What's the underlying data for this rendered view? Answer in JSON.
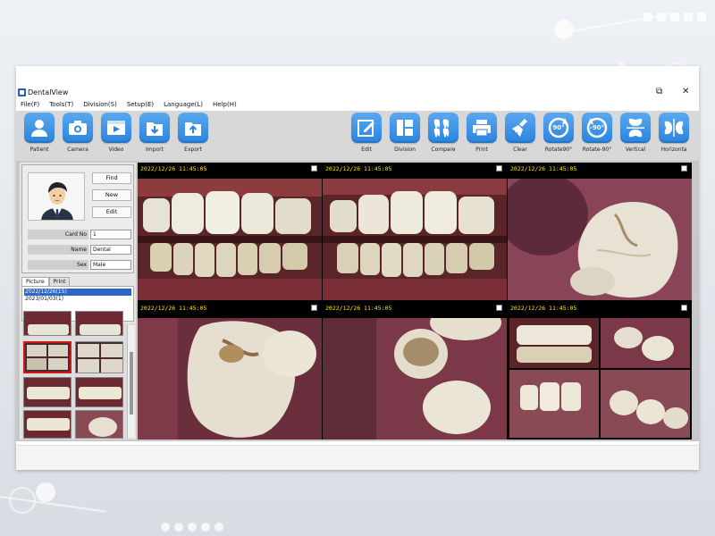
{
  "window": {
    "title": "DentalView",
    "restore_symbol": "⧉",
    "close_symbol": "✕"
  },
  "menu": [
    "File(F)",
    "Tools(T)",
    "Division(S)",
    "Setup(E)",
    "Language(L)",
    "Help(H)"
  ],
  "toolbar_left": [
    {
      "label": "Patient",
      "icon": "user-icon"
    },
    {
      "label": "Camera",
      "icon": "camera-icon"
    },
    {
      "label": "Video",
      "icon": "video-icon"
    },
    {
      "label": "Import",
      "icon": "import-icon"
    },
    {
      "label": "Export",
      "icon": "export-icon"
    }
  ],
  "toolbar_right": [
    {
      "label": "Edit",
      "icon": "edit-icon"
    },
    {
      "label": "Division",
      "icon": "division-icon"
    },
    {
      "label": "Compare",
      "icon": "compare-icon"
    },
    {
      "label": "Print",
      "icon": "printer-icon"
    },
    {
      "label": "Clear",
      "icon": "broom-icon"
    },
    {
      "label": "Rotate90°",
      "icon": "rotate-cw-icon",
      "badge": "90°"
    },
    {
      "label": "Rotate-90°",
      "icon": "rotate-ccw-icon",
      "badge": "-90°"
    },
    {
      "label": "Vertical",
      "icon": "vertical-flip-icon"
    },
    {
      "label": "Horizonta",
      "icon": "horizontal-flip-icon"
    }
  ],
  "patient": {
    "find_label": "Find",
    "new_label": "New",
    "edit_label": "Edit",
    "card_label": "Card No",
    "card_value": "1",
    "name_label": "Name",
    "name_value": "Dental",
    "sex_label": "Sex",
    "sex_value": "Male"
  },
  "tabs": {
    "picture": "Picture",
    "print": "Print"
  },
  "dates": [
    {
      "text": "2022/12/26(15)",
      "selected": true
    },
    {
      "text": "2023/01/03(1)",
      "selected": false
    }
  ],
  "images": [
    {
      "timestamp": "2022/12/26 11:45:05",
      "view": "front-teeth"
    },
    {
      "timestamp": "2022/12/26 11:45:05",
      "view": "front-teeth"
    },
    {
      "timestamp": "2022/12/26 11:45:05",
      "view": "molar-closeup"
    },
    {
      "timestamp": "2022/12/26 11:45:05",
      "view": "molar-occlusal"
    },
    {
      "timestamp": "2022/12/26 11:45:05",
      "view": "molar-side"
    },
    {
      "timestamp": "2022/12/26 11:45:05",
      "view": "quad-composite"
    }
  ],
  "colors": {
    "toolbar_icon": "#2a84df",
    "timestamp": "#ffe800",
    "selection": "#2b67c9",
    "thumb_selected": "#d01818"
  }
}
